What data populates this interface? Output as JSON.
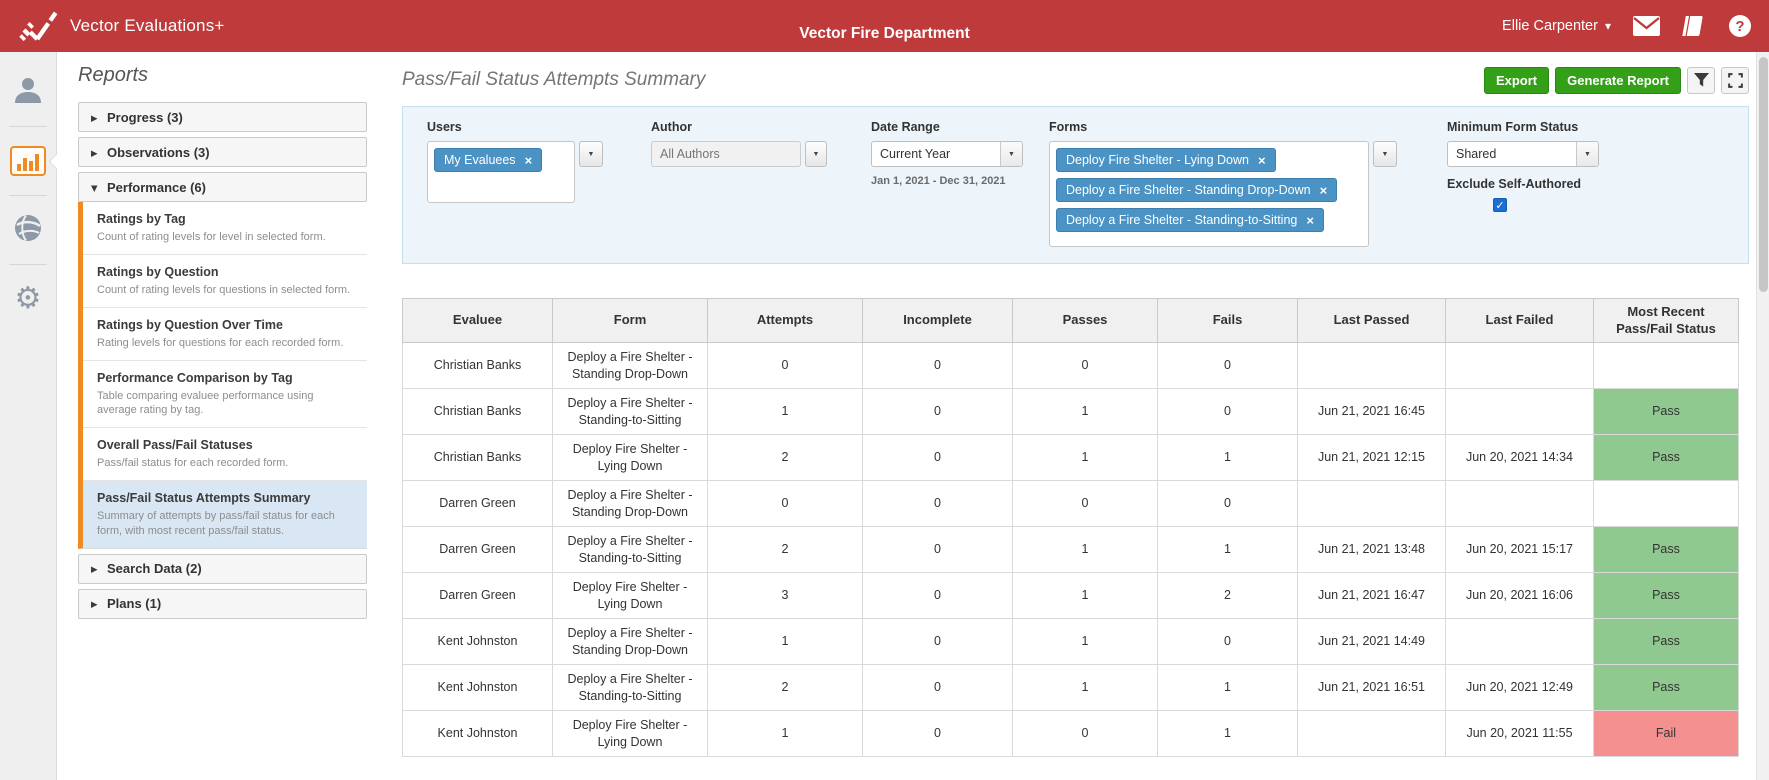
{
  "colors": {
    "header_red": "#bf3b3b",
    "accent_orange": "#ef8b23",
    "chip_blue": "#4a93c4",
    "button_green": "#34a018",
    "pass_green": "#8fc98f",
    "fail_red": "#f59090",
    "selected_item_blue": "#d9e6f4"
  },
  "header": {
    "app_name": "Vector Evaluations+",
    "org_title": "Vector Fire Department",
    "user_name": "Ellie Carpenter",
    "icons": [
      "mail-icon",
      "library-icon",
      "help-icon"
    ]
  },
  "nav_rail": {
    "items": [
      "person-icon",
      "bar-chart-icon (active)",
      "globe-icon",
      "gear-icon"
    ]
  },
  "reports_panel": {
    "title": "Reports",
    "sections": {
      "progress": "Progress (3)",
      "observations": "Observations (3)",
      "performance": "Performance (6)",
      "search_data": "Search Data (2)",
      "plans": "Plans (1)"
    },
    "performance_items": [
      {
        "title": "Ratings by Tag",
        "desc": "Count of rating levels for level in selected form."
      },
      {
        "title": "Ratings by Question",
        "desc": "Count of rating levels for questions in selected form."
      },
      {
        "title": "Ratings by Question Over Time",
        "desc": "Rating levels for questions for each recorded form."
      },
      {
        "title": "Performance Comparison by Tag",
        "desc": "Table comparing evaluee performance using average rating by tag."
      },
      {
        "title": "Overall Pass/Fail Statuses",
        "desc": "Pass/fail status for each recorded form."
      },
      {
        "title": "Pass/Fail Status Attempts Summary",
        "desc": "Summary of attempts by pass/fail status for each form, with most recent pass/fail status."
      }
    ],
    "selected_item": "Pass/Fail Status Attempts Summary"
  },
  "main": {
    "page_title": "Pass/Fail Status Attempts Summary",
    "export_label": "Export",
    "generate_report_label": "Generate Report"
  },
  "filters": {
    "users": {
      "label": "Users",
      "chips": [
        "My Evaluees"
      ]
    },
    "author": {
      "label": "Author",
      "placeholder": "All Authors"
    },
    "date_range": {
      "label": "Date Range",
      "value": "Current Year",
      "caption": "Jan 1, 2021 - Dec 31, 2021"
    },
    "forms": {
      "label": "Forms",
      "chips": [
        "Deploy Fire Shelter - Lying Down",
        "Deploy a Fire Shelter - Standing Drop-Down",
        "Deploy a Fire Shelter - Standing-to-Sitting"
      ]
    },
    "min_form_status": {
      "label": "Minimum Form Status",
      "value": "Shared"
    },
    "exclude_self_authored": {
      "label": "Exclude Self-Authored",
      "checked": true
    }
  },
  "table": {
    "columns": [
      "Evaluee",
      "Form",
      "Attempts",
      "Incomplete",
      "Passes",
      "Fails",
      "Last Passed",
      "Last Failed",
      "Most Recent Pass/Fail Status"
    ],
    "rows": [
      {
        "evaluee": "Christian Banks",
        "form": "Deploy a Fire Shelter - Standing Drop-Down",
        "attempts": "0",
        "incomplete": "0",
        "passes": "0",
        "fails": "0",
        "last_passed": "",
        "last_failed": "",
        "status": ""
      },
      {
        "evaluee": "Christian Banks",
        "form": "Deploy a Fire Shelter - Standing-to-Sitting",
        "attempts": "1",
        "incomplete": "0",
        "passes": "1",
        "fails": "0",
        "last_passed": "Jun 21, 2021 16:45",
        "last_failed": "",
        "status": "Pass"
      },
      {
        "evaluee": "Christian Banks",
        "form": "Deploy Fire Shelter - Lying Down",
        "attempts": "2",
        "incomplete": "0",
        "passes": "1",
        "fails": "1",
        "last_passed": "Jun 21, 2021 12:15",
        "last_failed": "Jun 20, 2021 14:34",
        "status": "Pass"
      },
      {
        "evaluee": "Darren Green",
        "form": "Deploy a Fire Shelter - Standing Drop-Down",
        "attempts": "0",
        "incomplete": "0",
        "passes": "0",
        "fails": "0",
        "last_passed": "",
        "last_failed": "",
        "status": ""
      },
      {
        "evaluee": "Darren Green",
        "form": "Deploy a Fire Shelter - Standing-to-Sitting",
        "attempts": "2",
        "incomplete": "0",
        "passes": "1",
        "fails": "1",
        "last_passed": "Jun 21, 2021 13:48",
        "last_failed": "Jun 20, 2021 15:17",
        "status": "Pass"
      },
      {
        "evaluee": "Darren Green",
        "form": "Deploy Fire Shelter - Lying Down",
        "attempts": "3",
        "incomplete": "0",
        "passes": "1",
        "fails": "2",
        "last_passed": "Jun 21, 2021 16:47",
        "last_failed": "Jun 20, 2021 16:06",
        "status": "Pass"
      },
      {
        "evaluee": "Kent Johnston",
        "form": "Deploy a Fire Shelter - Standing Drop-Down",
        "attempts": "1",
        "incomplete": "0",
        "passes": "1",
        "fails": "0",
        "last_passed": "Jun 21, 2021 14:49",
        "last_failed": "",
        "status": "Pass"
      },
      {
        "evaluee": "Kent Johnston",
        "form": "Deploy a Fire Shelter - Standing-to-Sitting",
        "attempts": "2",
        "incomplete": "0",
        "passes": "1",
        "fails": "1",
        "last_passed": "Jun 21, 2021 16:51",
        "last_failed": "Jun 20, 2021 12:49",
        "status": "Pass"
      },
      {
        "evaluee": "Kent Johnston",
        "form": "Deploy Fire Shelter - Lying Down",
        "attempts": "1",
        "incomplete": "0",
        "passes": "0",
        "fails": "1",
        "last_passed": "",
        "last_failed": "Jun 20, 2021 11:55",
        "status": "Fail"
      }
    ]
  }
}
